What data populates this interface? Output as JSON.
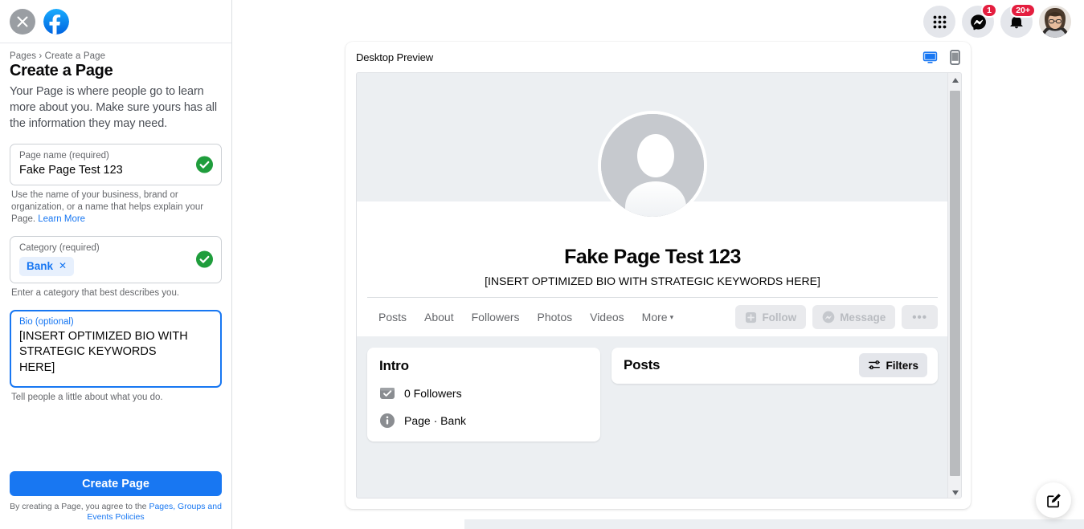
{
  "header": {
    "close_icon": "close-icon",
    "logo": "facebook-logo",
    "menu_icon": "grid-menu-icon",
    "messenger_icon": "messenger-icon",
    "messenger_badge": "1",
    "notifications_icon": "bell-icon",
    "notifications_badge": "20+",
    "avatar": "user-avatar"
  },
  "sidebar": {
    "breadcrumb": "Pages › Create a Page",
    "title": "Create a Page",
    "description": "Your Page is where people go to learn more about you. Make sure yours has all the information they may need.",
    "fields": {
      "page_name": {
        "label": "Page name (required)",
        "value": "Fake Page Test 123",
        "helper": "Use the name of your business, brand or organization, or a name that helps explain your Page.",
        "helper_link": "Learn More",
        "valid_icon": "check-circle-icon"
      },
      "category": {
        "label": "Category (required)",
        "chip_value": "Bank",
        "chip_remove_icon": "✕",
        "helper": "Enter a category that best describes you.",
        "valid_icon": "check-circle-icon"
      },
      "bio": {
        "label": "Bio (optional)",
        "value": "[INSERT OPTIMIZED BIO WITH STRATEGIC KEYWORDS HERE]",
        "helper": "Tell people a little about what you do.",
        "focused": true
      }
    },
    "submit_label": "Create Page",
    "terms_prefix": "By creating a Page, you agree to the ",
    "terms_link": "Pages, Groups and Events Policies"
  },
  "preview": {
    "title": "Desktop Preview",
    "desktop_icon": "desktop-icon",
    "mobile_icon": "mobile-icon",
    "active_view": "desktop",
    "accent_color": "#1877f2",
    "page": {
      "avatar_icon": "person-placeholder-icon",
      "name": "Fake Page Test 123",
      "bio": "[INSERT OPTIMIZED BIO WITH STRATEGIC KEYWORDS HERE]",
      "tabs": [
        {
          "label": "Posts"
        },
        {
          "label": "About"
        },
        {
          "label": "Followers"
        },
        {
          "label": "Photos"
        },
        {
          "label": "Videos"
        },
        {
          "label": "More",
          "caret": "▾"
        }
      ],
      "actions": [
        {
          "label": "Follow",
          "icon": "add-box-icon",
          "disabled": true
        },
        {
          "label": "Message",
          "icon": "messenger-icon",
          "disabled": true
        },
        {
          "label": "•••",
          "icon": "more-options-icon",
          "disabled": true
        }
      ],
      "intro": {
        "title": "Intro",
        "rows": [
          {
            "icon": "check-badge-icon",
            "text": "0 Followers"
          },
          {
            "icon": "info-icon",
            "text": "Page · Bank"
          }
        ]
      },
      "posts": {
        "title": "Posts",
        "filters_label": "Filters",
        "filters_icon": "tune-icon"
      }
    },
    "scrollbar": {
      "up_icon": "▲",
      "down_icon": "▼"
    }
  },
  "fab": {
    "icon": "compose-icon"
  }
}
